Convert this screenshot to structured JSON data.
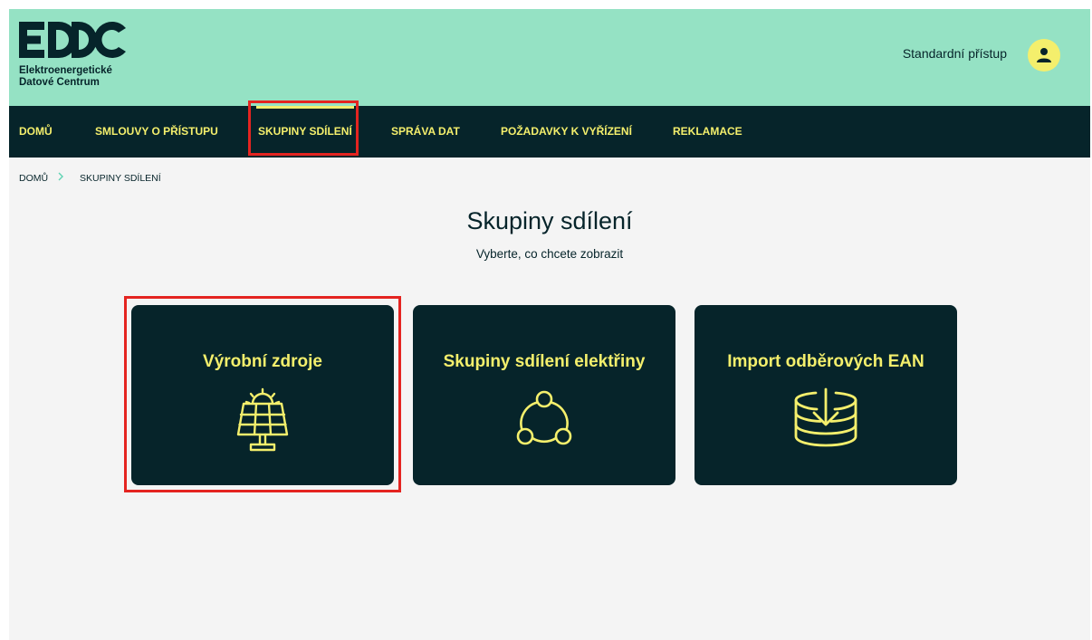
{
  "header": {
    "logo_line1": "Elektroenergetické",
    "logo_line2": "Datové Centrum",
    "user_label": "Standardní přístup"
  },
  "nav": {
    "items": [
      "DOMŮ",
      "SMLOUVY O PŘÍSTUPU",
      "SKUPINY SDÍLENÍ",
      "SPRÁVA DAT",
      "POŽADAVKY K VYŘÍZENÍ",
      "REKLAMACE"
    ],
    "active": "SKUPINY SDÍLENÍ"
  },
  "breadcrumb": {
    "home": "DOMŮ",
    "current": "SKUPINY SDÍLENÍ"
  },
  "page": {
    "title": "Skupiny sdílení",
    "subtitle": "Vyberte, co chcete zobrazit"
  },
  "cards": [
    {
      "title": "Výrobní zdroje",
      "icon": "solar-panel-icon"
    },
    {
      "title": "Skupiny sdílení elektřiny",
      "icon": "share-group-icon"
    },
    {
      "title": "Import odběrových EAN",
      "icon": "import-database-icon"
    }
  ],
  "colors": {
    "header_bg": "#95e2c4",
    "dark": "#06242a",
    "accent": "#f4ef6c",
    "highlight": "#e42420",
    "page_bg": "#f4f4f4"
  }
}
